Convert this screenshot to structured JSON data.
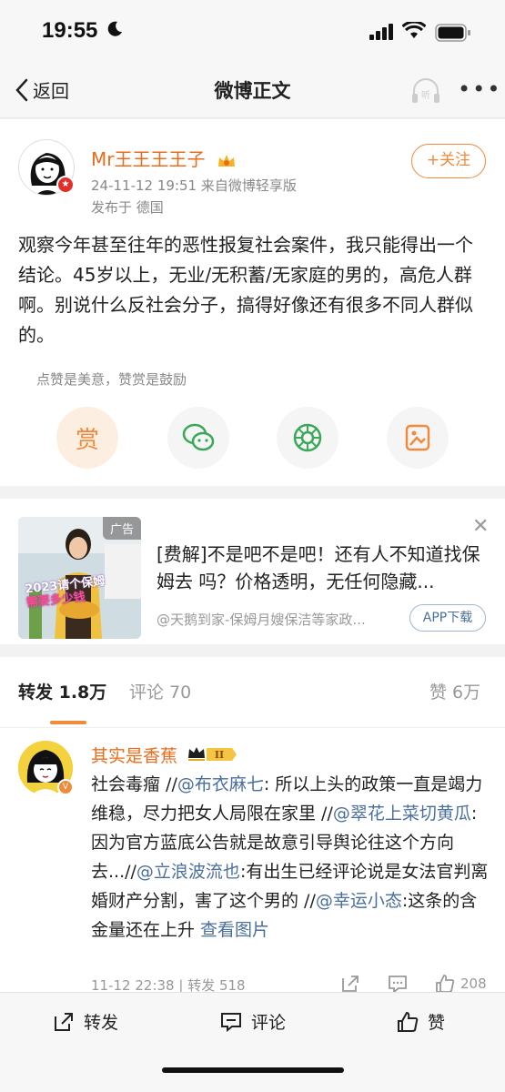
{
  "status": {
    "time": "19:55"
  },
  "nav": {
    "back_label": "返回",
    "title": "微博正文",
    "listen_label": "听"
  },
  "post": {
    "username": "Mr王王王王子",
    "datetime_source": "24-11-12 19:51  来自微博轻享版",
    "location": "发布于 德国",
    "follow_label": "+关注",
    "content": "观察今年甚至往年的恶性报复社会案件，我只能得出一个结论。45岁以上，无业/无积蓄/无家庭的男的，高危人群啊。别说什么反社会分子，搞得好像还有很多不同人群似的。",
    "reward_tip": "点赞是美意，赞赏是鼓励",
    "reward_label": "赏"
  },
  "ad": {
    "tag": "广告",
    "image_text_1": "2023请个保姆",
    "image_text_2": "需要多少钱",
    "title": "[费解]不是吧不是吧！还有人不知道找保姆去 吗？价格透明，无任何隐藏...",
    "source": "@天鹅到家-保姆月嫂保洁等家政...",
    "button_label": "APP下载"
  },
  "tabs": {
    "repost": "转发 1.8万",
    "comment": "评论 70",
    "like": "赞 6万"
  },
  "repost": {
    "name": "其实是香蕉",
    "level": "II",
    "segments": [
      {
        "t": "社会毒瘤 //",
        "at": false
      },
      {
        "t": "@布衣麻七",
        "at": true
      },
      {
        "t": ": 所以上头的政策一直是竭力维稳，尽力把女人局限在家里 //",
        "at": false
      },
      {
        "t": "@翠花上菜切黄瓜",
        "at": true
      },
      {
        "t": ": 因为官方蓝底公告就是故意引导舆论往这个方向去...//",
        "at": false
      },
      {
        "t": "@立浪波流也",
        "at": true
      },
      {
        "t": ":有出生已经评论说是女法官判离婚财产分割，害了这个男的 //",
        "at": false
      },
      {
        "t": "@幸运小态",
        "at": true
      },
      {
        "t": ":这条的含金量还在上升 ",
        "at": false
      },
      {
        "t": "查看图片",
        "at": true
      }
    ],
    "time": "11-12 22:38",
    "repost_count": "转发 518",
    "like_count": "208"
  },
  "bottom": {
    "repost": "转发",
    "comment": "评论",
    "like": "赞"
  },
  "colors": {
    "accent": "#f08a3c",
    "name": "#e86c1b",
    "link": "#4a6f9c"
  }
}
